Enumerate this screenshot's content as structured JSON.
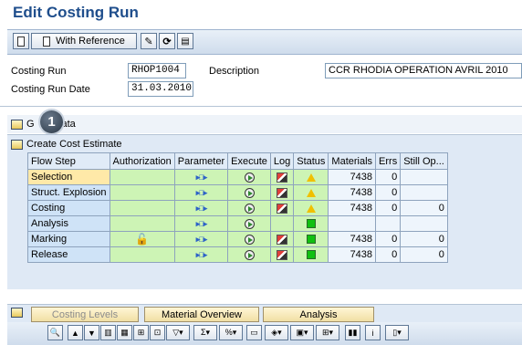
{
  "title": "Edit Costing Run",
  "toolbar": {
    "with_reference_label": "With Reference"
  },
  "header": {
    "costing_run_label": "Costing Run",
    "costing_run_value": "RHOP1004",
    "description_label": "Description",
    "description_value": "CCR RHODIA OPERATION AVRIL 2010",
    "costing_run_date_label": "Costing Run Date",
    "costing_run_date_value": "31.03.2010"
  },
  "sections": {
    "general_data_label_start": "G",
    "general_data_label_end": "Data",
    "create_cost_estimate_label": "Create Cost Estimate",
    "callout_number": "1"
  },
  "grid": {
    "columns": [
      "Flow Step",
      "Authorization",
      "Parameter",
      "Execute",
      "Log",
      "Status",
      "Materials",
      "Errs",
      "Still Op..."
    ],
    "rows": [
      {
        "step": "Selection",
        "auth": "",
        "log": true,
        "status": "yellow",
        "materials": "7438",
        "errs": "0",
        "still": ""
      },
      {
        "step": "Struct. Explosion",
        "auth": "",
        "log": true,
        "status": "yellow",
        "materials": "7438",
        "errs": "0",
        "still": ""
      },
      {
        "step": "Costing",
        "auth": "",
        "log": true,
        "status": "yellow",
        "materials": "7438",
        "errs": "0",
        "still": "0"
      },
      {
        "step": "Analysis",
        "auth": "",
        "log": false,
        "status": "green",
        "materials": "",
        "errs": "",
        "still": ""
      },
      {
        "step": "Marking",
        "auth": "lock",
        "log": true,
        "status": "green",
        "materials": "7438",
        "errs": "0",
        "still": "0"
      },
      {
        "step": "Release",
        "auth": "",
        "log": true,
        "status": "green",
        "materials": "7438",
        "errs": "0",
        "still": "0"
      }
    ]
  },
  "tabs": {
    "costing_levels": "Costing Levels",
    "material_overview": "Material Overview",
    "analysis": "Analysis"
  },
  "colors": {
    "title": "#1f4e8c",
    "status_yellow": "#f0c000",
    "status_green": "#11c011"
  }
}
